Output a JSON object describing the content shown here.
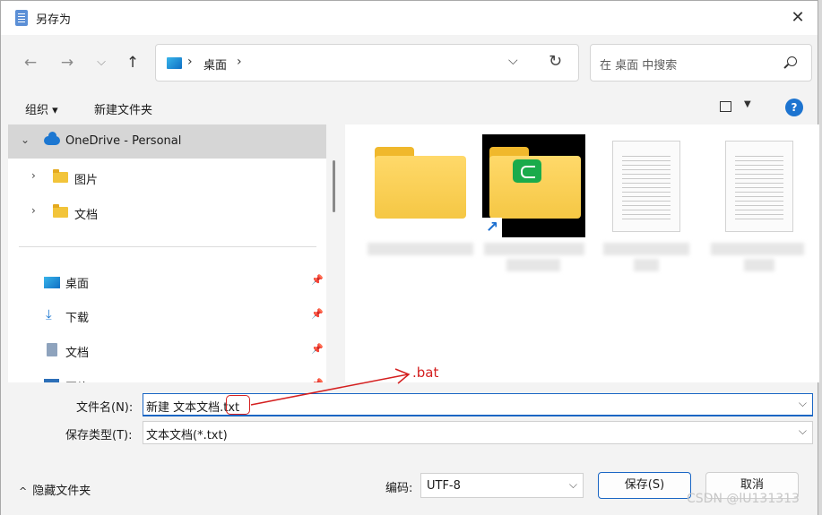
{
  "window": {
    "title": "另存为",
    "close": "✕"
  },
  "nav": {
    "back": "←",
    "forward": "→",
    "recent": "⌵",
    "up": "↑",
    "address_chevron": "›",
    "crumb": "桌面",
    "address_dropdown": "⌵",
    "refresh": "↻",
    "search_placeholder": "在 桌面 中搜索"
  },
  "toolbar": {
    "organize": "组织 ▾",
    "new_folder": "新建文件夹",
    "help": "?"
  },
  "sidebar": {
    "items": [
      {
        "label": "OneDrive - Personal",
        "expander": "⌄"
      },
      {
        "label": "图片",
        "expander": "›"
      },
      {
        "label": "文档",
        "expander": "›"
      },
      {
        "label": "桌面",
        "pin": "📌"
      },
      {
        "label": "下载",
        "pin": "📌"
      },
      {
        "label": "文档",
        "pin": "📌"
      },
      {
        "label": "图片",
        "pin": "📌"
      }
    ]
  },
  "form": {
    "filename_label": "文件名(N):",
    "filename_value": "新建 文本文档.txt",
    "filetype_label": "保存类型(T):",
    "filetype_value": "文本文档(*.txt)",
    "dropdown": "⌵"
  },
  "annotation": ".bat",
  "footer": {
    "hide_folders": "隐藏文件夹",
    "hide_caret": "^",
    "encoding_label": "编码:",
    "encoding_value": "UTF-8",
    "save": "保存(S)",
    "cancel": "取消"
  },
  "watermark": "CSDN @lU131313",
  "colors": {
    "accent": "#1a66c4",
    "annotation": "#d41f1f"
  }
}
